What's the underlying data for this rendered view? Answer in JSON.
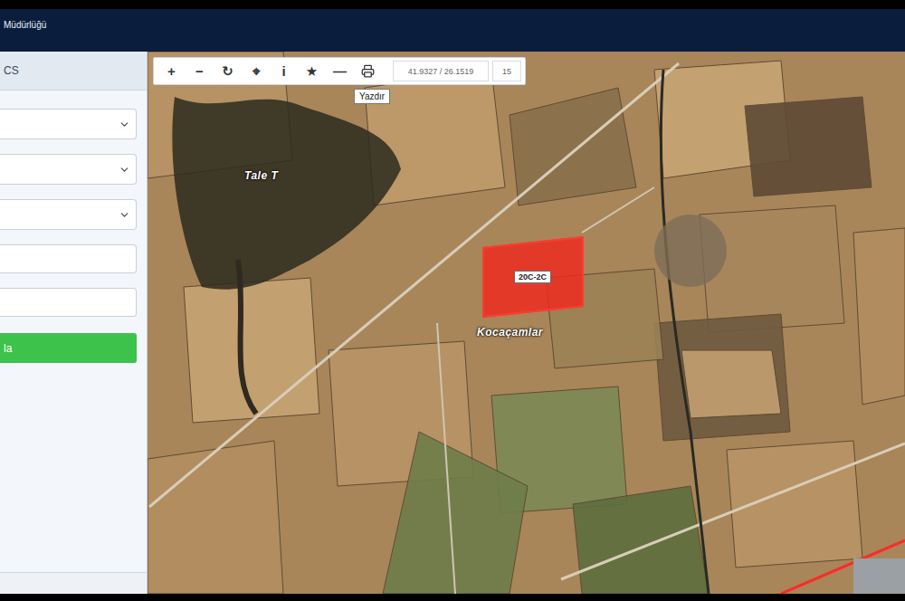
{
  "header": {
    "title": "Müdürlüğü"
  },
  "sidebar": {
    "title": "CS",
    "fields": [
      {
        "kind": "select"
      },
      {
        "kind": "select"
      },
      {
        "kind": "select"
      },
      {
        "kind": "input"
      },
      {
        "kind": "input"
      }
    ],
    "button": "la"
  },
  "toolbar": {
    "tools": [
      {
        "kind": "glyph",
        "label": "+"
      },
      {
        "kind": "glyph",
        "label": "−"
      },
      {
        "kind": "glyph",
        "label": "↻"
      },
      {
        "kind": "glyph",
        "label": "⌖"
      },
      {
        "kind": "glyph",
        "label": "i"
      },
      {
        "kind": "glyph",
        "label": "★"
      },
      {
        "kind": "glyph",
        "label": "—"
      },
      {
        "kind": "print",
        "label": ""
      }
    ],
    "coordinates": "41.9327 / 26.1519",
    "zoom": "15",
    "tooltip": "Yazdır"
  },
  "map": {
    "labels": {
      "area": "Tale T",
      "village": "Kocaçamlar"
    },
    "parcel": {
      "label": "20C-2C"
    }
  }
}
